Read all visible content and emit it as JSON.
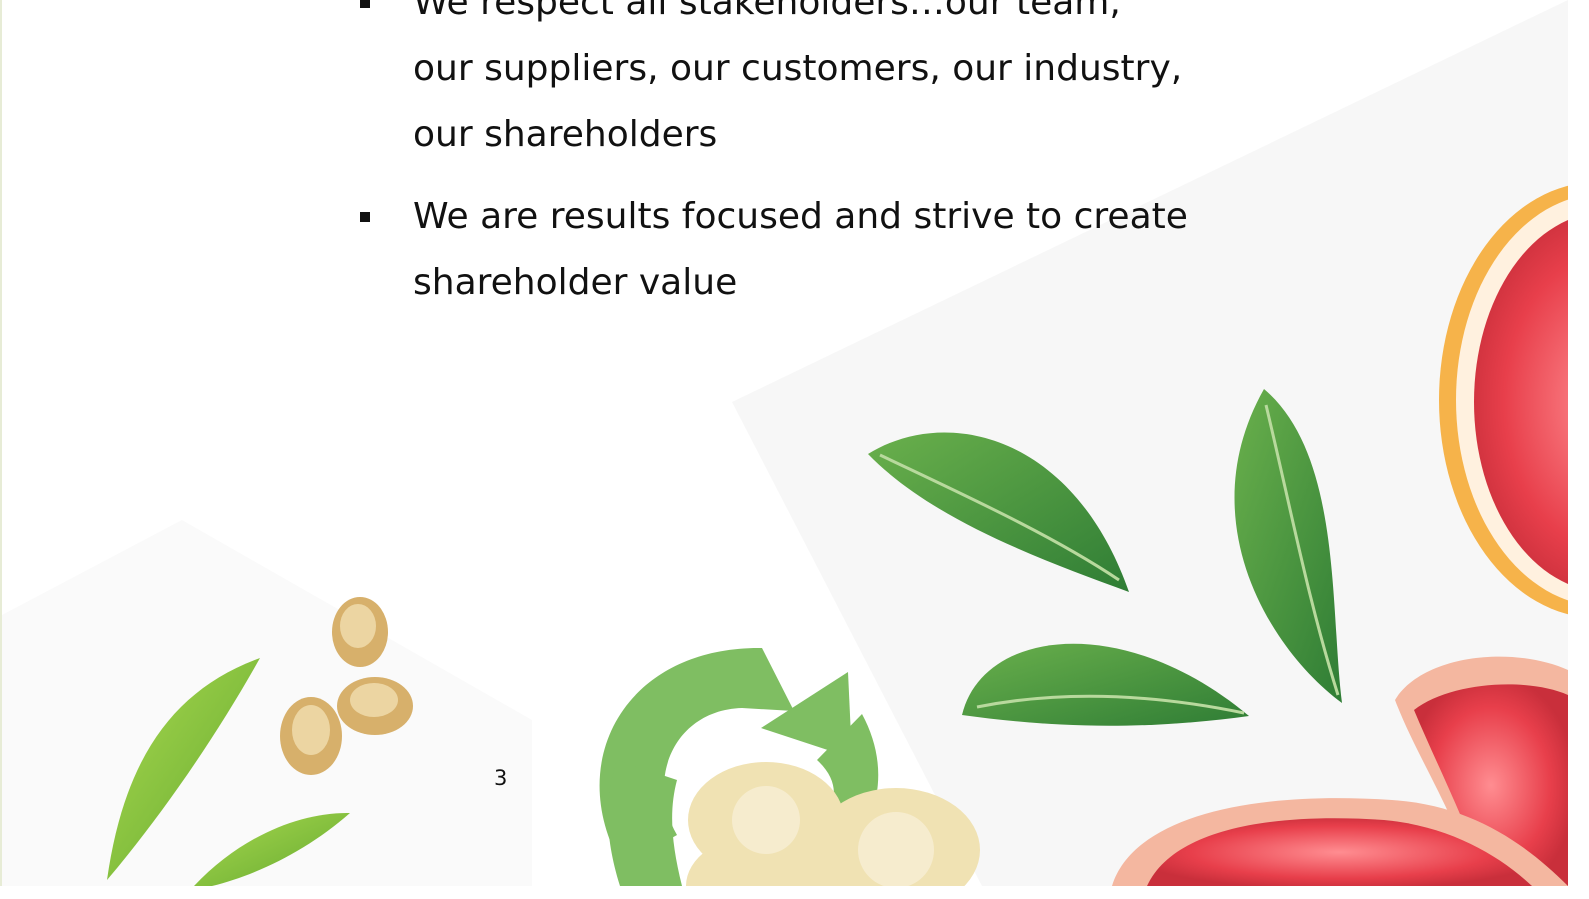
{
  "slide": {
    "bullets": [
      {
        "text": "We respect all stakeholders…our team, our suppliers, our customers, our industry, our shareholders"
      },
      {
        "text": "We are results focused and strive to create shareholder value"
      }
    ],
    "page_number": "3"
  },
  "colors": {
    "text": "#111111",
    "leaf_dark": "#3f8f3c",
    "leaf_light": "#8ecb42",
    "recycle_green": "#7fbe62",
    "grapefruit_pulp": "#e83f4b",
    "grapefruit_rind": "#f6b34a",
    "banana": "#f0e2b3",
    "nut": "#d7b06b"
  },
  "images": [
    "green-leaf-image",
    "grapefruit-image",
    "banana-image",
    "nut-image",
    "recycle-icon"
  ]
}
